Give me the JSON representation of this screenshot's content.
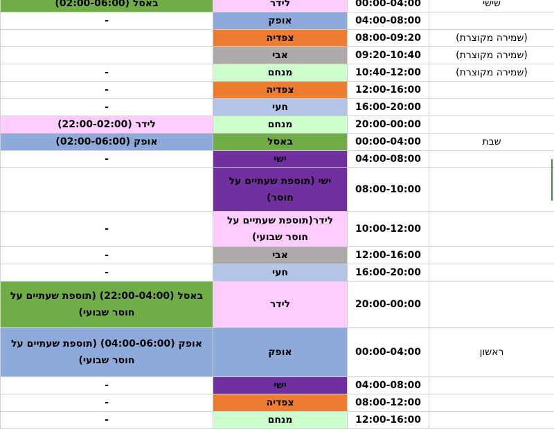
{
  "colors": {
    "green": "#70ad47",
    "pink": "#ffccff",
    "blue": "#8eaadb",
    "orange": "#ed7d31",
    "gray": "#aeaaaa",
    "lightgreen": "#ccffcc",
    "lightblue": "#b4c6e7",
    "purple": "#7030a0",
    "white": "#ffffff"
  },
  "rows": [
    {
      "note": "באסל (02:00-06:00)",
      "note_color": "green",
      "person": "לידר",
      "person_color": "pink",
      "time": "00:00-04:00",
      "day": "שישי"
    },
    {
      "note": "-",
      "note_color": "white",
      "person": "אופק",
      "person_color": "blue",
      "time": "04:00-08:00",
      "day": ""
    },
    {
      "note": "",
      "note_color": "white",
      "person": "צפדיה",
      "person_color": "orange",
      "time": "08:00-09:20",
      "day": "(שמירה מקוצרת)"
    },
    {
      "note": "",
      "note_color": "white",
      "person": "אבי",
      "person_color": "gray",
      "time": "09:20-10:40",
      "day": "(שמירה מקוצרת)"
    },
    {
      "note": "-",
      "note_color": "white",
      "person": "מנחם",
      "person_color": "lightgreen",
      "time": "10:40-12:00",
      "day": "(שמירה מקוצרת)"
    },
    {
      "note": "-",
      "note_color": "white",
      "person": "צפדיה",
      "person_color": "orange",
      "time": "12:00-16:00",
      "day": ""
    },
    {
      "note": "-",
      "note_color": "white",
      "person": "חעי",
      "person_color": "lightblue",
      "time": "16:00-20:00",
      "day": ""
    },
    {
      "note": "לידר (22:00-02:00)",
      "note_color": "pink",
      "person": "מנחם",
      "person_color": "lightgreen",
      "time": "20:00-00:00",
      "day": ""
    },
    {
      "note": "אופק (02:00-06:00)",
      "note_color": "blue",
      "person": "באסל",
      "person_color": "green",
      "time": "00:00-04:00",
      "day": "שבת"
    },
    {
      "note": "-",
      "note_color": "white",
      "person": "ישי",
      "person_color": "purple",
      "time": "04:00-08:00",
      "day": ""
    },
    {
      "note": "",
      "note_color": "white",
      "person": "ישי (תוספת שעתיים על חוסר)",
      "person_color": "purple",
      "time": "08:00-10:00",
      "day": ""
    },
    {
      "note": "-",
      "note_color": "white",
      "person": "לידר(תוספת שעתיים על חוסר שבועי)",
      "person_color": "pink",
      "time": "10:00-12:00",
      "day": ""
    },
    {
      "note": "-",
      "note_color": "white",
      "person": "אבי",
      "person_color": "gray",
      "time": "12:00-16:00",
      "day": ""
    },
    {
      "note": "-",
      "note_color": "white",
      "person": "חעי",
      "person_color": "lightblue",
      "time": "16:00-20:00",
      "day": ""
    },
    {
      "note": "באסל (22:00-04:00) (תוספת שעתיים על חוסר שבועי)",
      "note_color": "green",
      "person": "לידר",
      "person_color": "pink",
      "time": "20:00-00:00",
      "day": ""
    },
    {
      "note": "אופק (04:00-06:00) (תוספת שעתיים על חוסר שבועי)",
      "note_color": "blue",
      "person": "אופק",
      "person_color": "blue",
      "time": "00:00-04:00",
      "day": "ראשון"
    },
    {
      "note": "-",
      "note_color": "white",
      "person": "ישי",
      "person_color": "purple",
      "time": "04:00-08:00",
      "day": ""
    },
    {
      "note": "-",
      "note_color": "white",
      "person": "צפדיה",
      "person_color": "orange",
      "time": "08:00-12:00",
      "day": ""
    },
    {
      "note": "-",
      "note_color": "white",
      "person": "מנחם",
      "person_color": "lightgreen",
      "time": "12:00-16:00",
      "day": ""
    }
  ]
}
